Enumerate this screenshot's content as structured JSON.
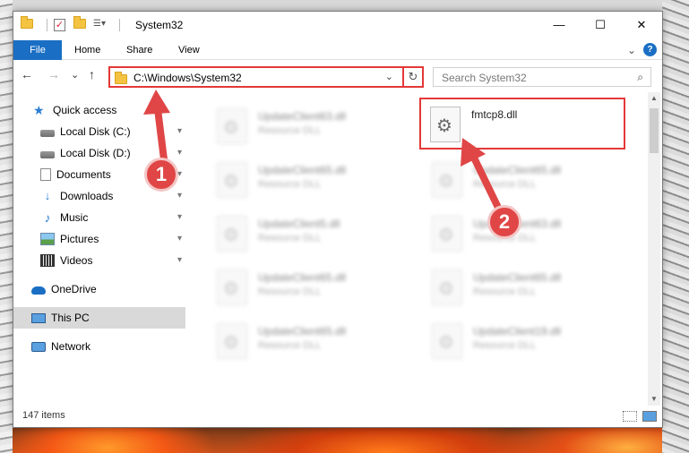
{
  "window": {
    "title": "System32",
    "controls": {
      "minimize": "—",
      "maximize": "☐",
      "close": "✕"
    }
  },
  "ribbon": {
    "tabs": [
      "File",
      "Home",
      "Share",
      "View"
    ],
    "expand": "⌄",
    "help": "?"
  },
  "navigation": {
    "back": "←",
    "forward": "→",
    "recent": "⌄",
    "up": "↑",
    "address": "C:\\Windows\\System32",
    "address_dropdown": "⌄",
    "refresh": "↻",
    "search_placeholder": "Search System32",
    "search_icon": "⌕"
  },
  "sidebar": {
    "items": [
      {
        "label": "Quick access",
        "icon": "star-icon",
        "pinned": false
      },
      {
        "label": "Local Disk (C:)",
        "icon": "drive-icon",
        "pinned": true
      },
      {
        "label": "Local Disk (D:)",
        "icon": "drive-icon",
        "pinned": true
      },
      {
        "label": "Documents",
        "icon": "documents-icon",
        "pinned": true
      },
      {
        "label": "Downloads",
        "icon": "downloads-icon",
        "pinned": true
      },
      {
        "label": "Music",
        "icon": "music-icon",
        "pinned": true
      },
      {
        "label": "Pictures",
        "icon": "pictures-icon",
        "pinned": true
      },
      {
        "label": "Videos",
        "icon": "videos-icon",
        "pinned": true
      },
      {
        "label": "OneDrive",
        "icon": "onedrive-icon",
        "pinned": false
      },
      {
        "label": "This PC",
        "icon": "computer-icon",
        "pinned": false,
        "selected": true
      },
      {
        "label": "Network",
        "icon": "network-icon",
        "pinned": false
      }
    ],
    "pin_glyph": "📌"
  },
  "files": [
    {
      "name": "UpdateClient63.dll",
      "type": "Resource DLL"
    },
    {
      "name": "fmtcp8.dll",
      "type": "",
      "highlighted": true
    },
    {
      "name": "UpdateClient65.dll",
      "type": "Resource DLL"
    },
    {
      "name": "UpdateClient65.dll",
      "type": "Resource DLL"
    },
    {
      "name": "UpdateClient5.dll",
      "type": "Resource DLL"
    },
    {
      "name": "UpdateClient63.dll",
      "type": "Resource DLL"
    },
    {
      "name": "UpdateClient65.dll",
      "type": "Resource DLL"
    },
    {
      "name": "UpdateClient65.dll",
      "type": "Resource DLL"
    },
    {
      "name": "UpdateClient65.dll",
      "type": "Resource DLL"
    },
    {
      "name": "UpdateClient19.dll",
      "type": "Resource DLL"
    }
  ],
  "status": {
    "item_count": "147 items"
  },
  "annotations": {
    "step1": "1",
    "step2": "2",
    "color": "#e04646"
  }
}
